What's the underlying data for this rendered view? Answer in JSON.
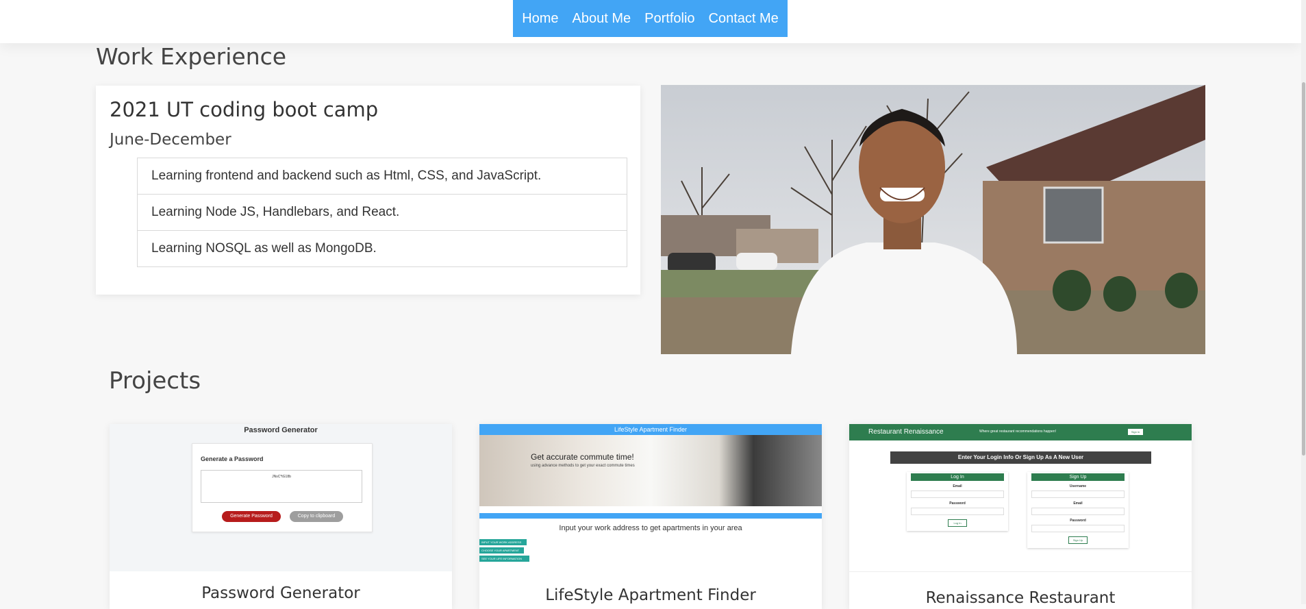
{
  "nav": {
    "items": [
      "Home",
      "About Me",
      "Portfolio",
      "Contact Me"
    ]
  },
  "work_experience": {
    "heading": "Work Experience",
    "title": "2021 UT coding boot camp",
    "period": "June-December",
    "items": [
      "Learning frontend and backend such as Html, CSS, and JavaScript.",
      "Learning Node JS, Handlebars, and React.",
      "Learning NOSQL as well as MongoDB."
    ]
  },
  "projects": {
    "heading": "Projects",
    "cards": [
      {
        "title": "Password Generator",
        "thumb": {
          "header": "Password Generator",
          "box_heading": "Generate a Password",
          "password": "JNsC*tG18b",
          "generate_button": "Generate Password",
          "copy_button": "Copy to clipboard"
        }
      },
      {
        "title": "LifeStyle Apartment Finder",
        "thumb": {
          "header": "LifeStyle Apartment Finder",
          "hero": "Get accurate commute time!",
          "hero_sub": "using advance methods to get your exact commute times",
          "input_text": "Input your work address to get apartments in your area",
          "chips": [
            "INPUT YOUR WORK ADDRESS",
            "CHOOSE YOUR APARTMENT",
            "SEE YOUR LIFE INFORMATION"
          ]
        }
      },
      {
        "title": "Renaissance Restaurant",
        "thumb": {
          "brand": "Restaurant Renaissance",
          "tagline": "Where great restaurant recommendations happen!",
          "sign_in": "Sign in",
          "banner": "Enter Your Login Info Or Sign Up As A New User",
          "login": {
            "header": "Log In",
            "labels": [
              "Email",
              "Password"
            ],
            "button": "Log In"
          },
          "signup": {
            "header": "Sign Up",
            "labels": [
              "Username",
              "Email",
              "Password"
            ],
            "button": "Sign Up"
          }
        }
      }
    ]
  },
  "colors": {
    "nav_bg": "#42a5f5",
    "accent_green": "#2e7d4f",
    "red_button": "#b71c1c"
  }
}
